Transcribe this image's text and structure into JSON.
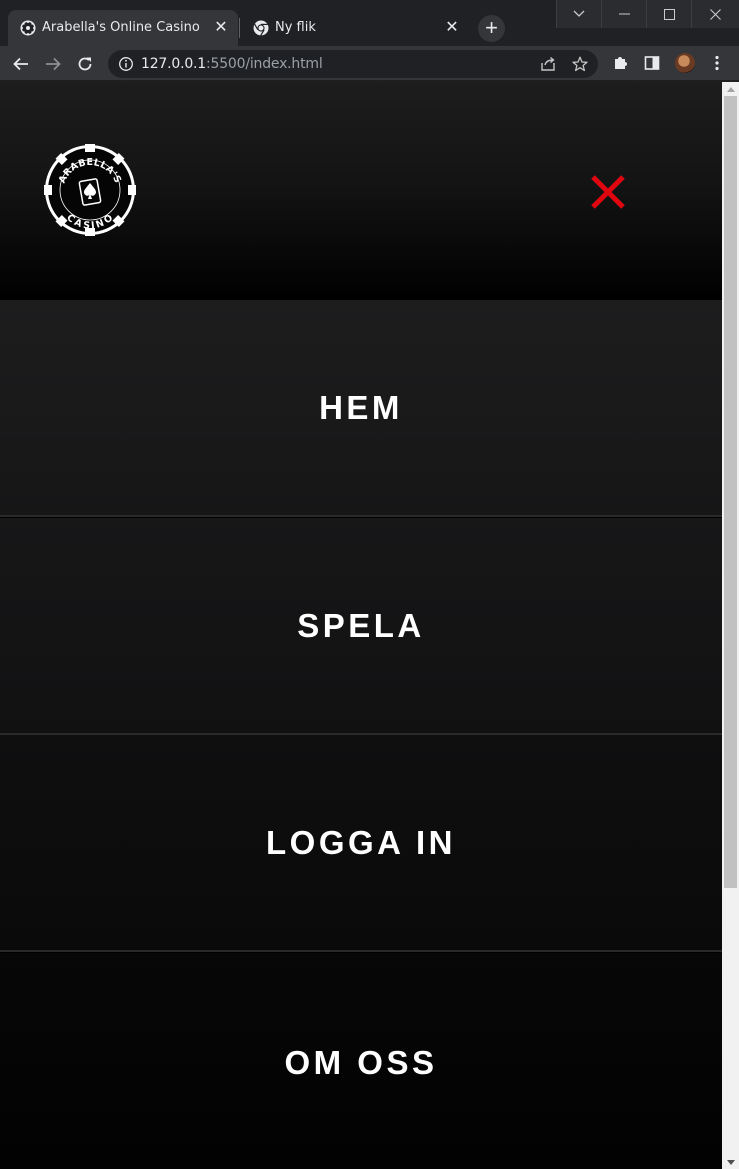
{
  "browser": {
    "tabs": [
      {
        "title": "Arabella's Online Casino",
        "active": true
      },
      {
        "title": "Ny flik",
        "active": false
      }
    ],
    "url_host": "127.0.0.1",
    "url_rest": ":5500/index.html"
  },
  "site": {
    "logo_text_top": "ARABELLA'S",
    "logo_text_bottom": "CASINO",
    "close_icon_color": "#e0060f",
    "menu": [
      {
        "label": "HEM"
      },
      {
        "label": "SPELA"
      },
      {
        "label": "LOGGA IN"
      },
      {
        "label": "OM OSS"
      }
    ]
  },
  "colors": {
    "chrome_bg": "#202124",
    "chrome_tab": "#35363a",
    "page_bg": "#000000",
    "menu_text": "#ffffff"
  }
}
